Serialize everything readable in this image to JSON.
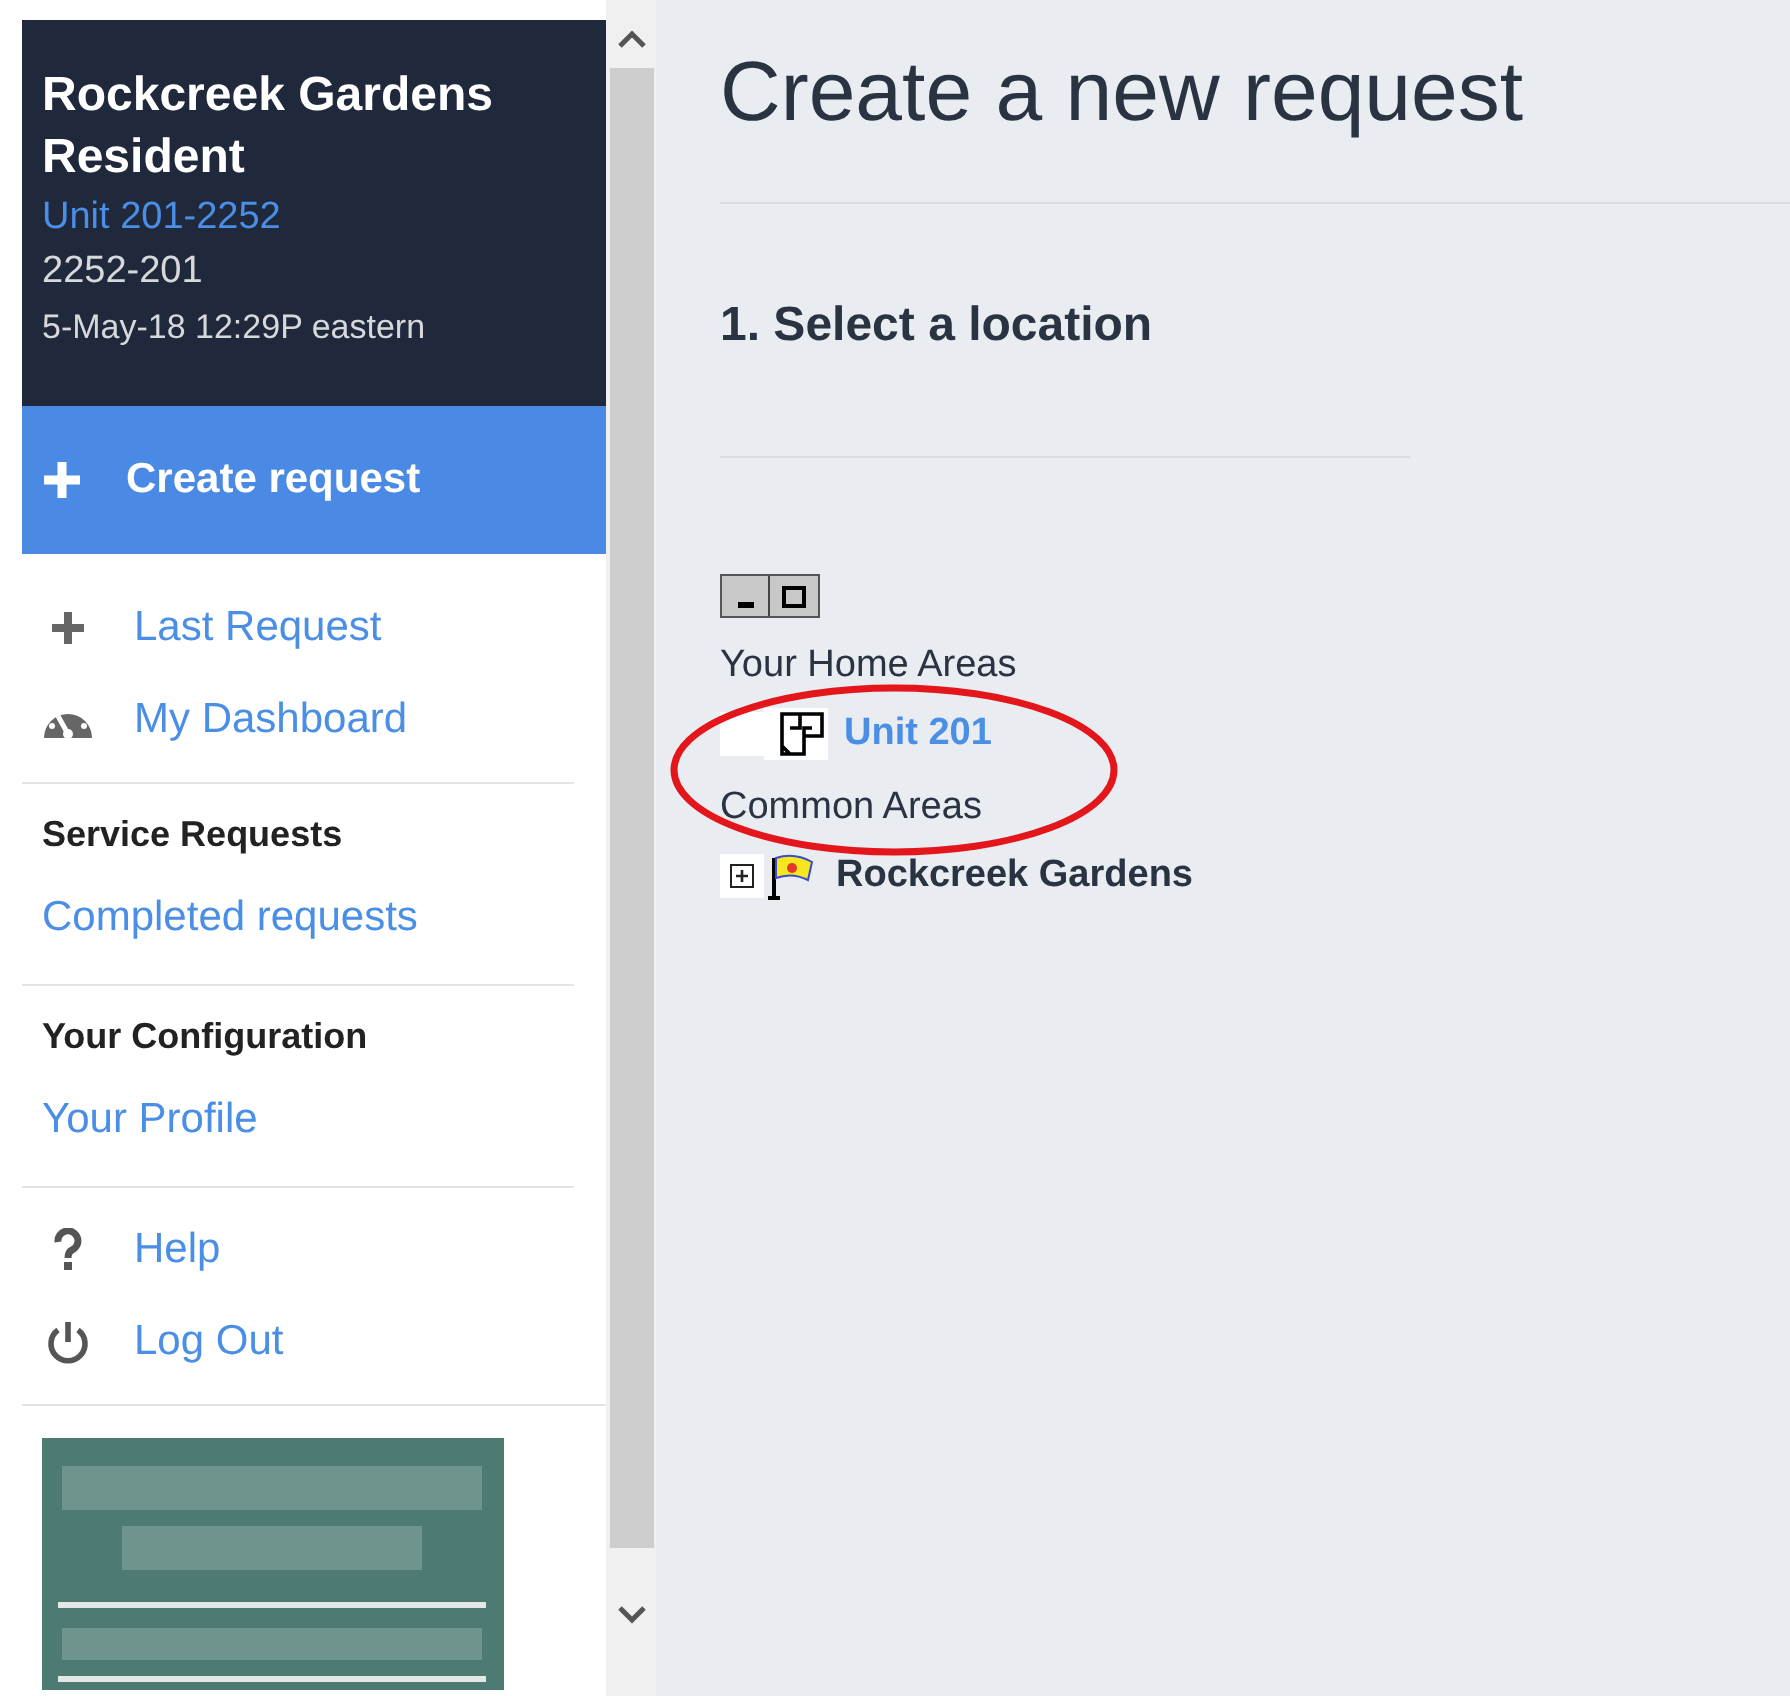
{
  "header": {
    "name": "Rockcreek Gardens Resident",
    "unit_link": "Unit 201-2252",
    "account": "2252-201",
    "datetime": "5-May-18 12:29P eastern"
  },
  "create_button": {
    "label": "Create request",
    "selected": true
  },
  "nav_groups": [
    {
      "items": [
        {
          "label": "Last Request"
        },
        {
          "label": "My Dashboard"
        }
      ]
    },
    {
      "heading": "Service Requests",
      "items": [
        {
          "label": "Completed requests"
        }
      ]
    },
    {
      "heading": "Your Configuration",
      "items": [
        {
          "label": "Your Profile"
        }
      ]
    },
    {
      "items": [
        {
          "label": "Help"
        },
        {
          "label": "Log Out"
        }
      ]
    }
  ],
  "page_title": "Create a new request",
  "step_title": "1. Select a location",
  "tree": [
    {
      "heading": "Your Home Areas",
      "nodes": [
        {
          "label": "Unit 201",
          "kind": "unit",
          "expander": false,
          "link": true
        }
      ]
    },
    {
      "heading": "Common Areas",
      "nodes": [
        {
          "label": "Rockcreek Gardens",
          "kind": "flag",
          "expander": true,
          "link": false
        }
      ]
    }
  ]
}
